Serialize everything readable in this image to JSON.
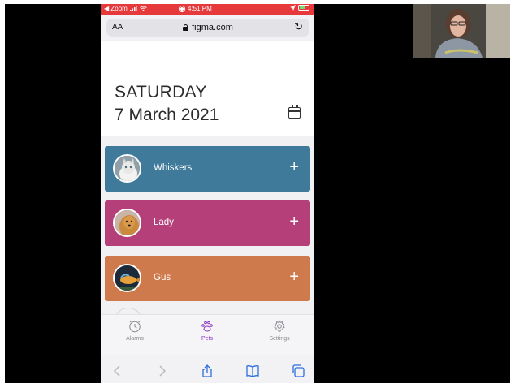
{
  "status_bar": {
    "back_app": "◀ Zoom",
    "time": "4:51 PM"
  },
  "url_bar": {
    "text_size": "AA",
    "domain": "figma.com"
  },
  "header": {
    "day": "SATURDAY",
    "date": "7 March 2021"
  },
  "pets": [
    {
      "name": "Whiskers",
      "color": "#3f7a9a",
      "add_label": "+"
    },
    {
      "name": "Lady",
      "color": "#b43f79",
      "add_label": "+"
    },
    {
      "name": "Gus",
      "color": "#cf7a4c",
      "add_label": "+"
    }
  ],
  "tabs": [
    {
      "label": "Alarms",
      "icon": "clock-icon",
      "active": false
    },
    {
      "label": "Pets",
      "icon": "paw-icon",
      "active": true
    },
    {
      "label": "Settings",
      "icon": "gear-icon",
      "active": false
    }
  ],
  "colors": {
    "status_bar": "#e6393b",
    "active_tab": "#8c2ec2"
  }
}
